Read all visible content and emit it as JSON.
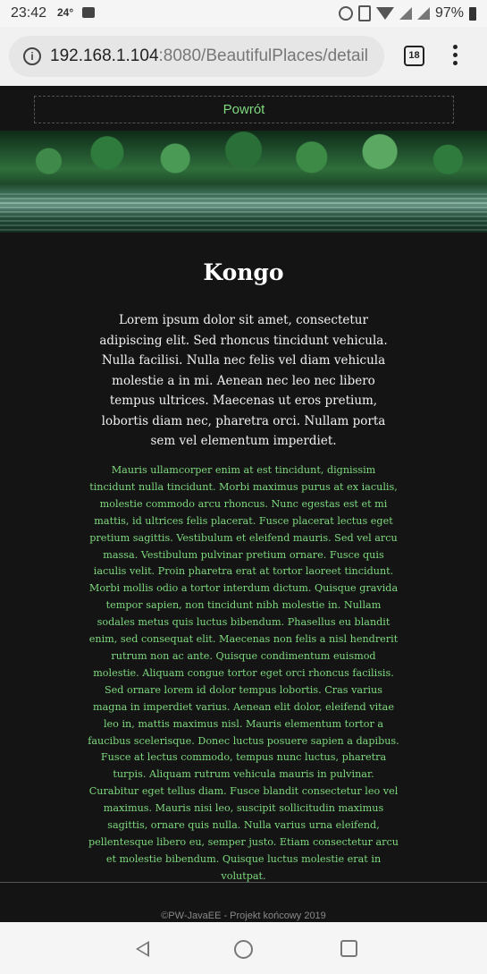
{
  "status_bar": {
    "time": "23:42",
    "temperature": "24°",
    "battery": "97%",
    "icons": [
      "image-icon",
      "alarm-icon",
      "vibrate-icon",
      "wifi-icon",
      "signal-icon",
      "battery-icon"
    ]
  },
  "browser": {
    "url_host": "192.168.1.104",
    "url_rest": ":8080/BeautifulPlaces/detail",
    "tab_count": "18",
    "info_icon_glyph": "i"
  },
  "page": {
    "back_button": "Powrót",
    "title": "Kongo",
    "intro": "Lorem ipsum dolor sit amet, consectetur adipiscing elit. Sed rhoncus tincidunt vehicula. Nulla facilisi. Nulla nec felis vel diam vehicula molestie a in mi. Aenean nec leo nec libero tempus ultrices. Maecenas ut eros pretium, lobortis diam nec, pharetra orci. Nullam porta sem vel elementum imperdiet.",
    "body": "Mauris ullamcorper enim at est tincidunt, dignissim tincidunt nulla tincidunt. Morbi maximus purus at ex iaculis, molestie commodo arcu rhoncus. Nunc egestas est et mi mattis, id ultrices felis placerat. Fusce placerat lectus eget pretium sagittis. Vestibulum et eleifend mauris. Sed vel arcu massa. Vestibulum pulvinar pretium ornare. Fusce quis iaculis velit. Proin pharetra erat at tortor laoreet tincidunt. Morbi mollis odio a tortor interdum dictum. Quisque gravida tempor sapien, non tincidunt nibh molestie in. Nullam sodales metus quis luctus bibendum. Phasellus eu blandit enim, sed consequat elit. Maecenas non felis a nisl hendrerit rutrum non ac ante. Quisque condimentum euismod molestie. Aliquam congue tortor eget orci rhoncus facilisis. Sed ornare lorem id dolor tempus lobortis. Cras varius magna in imperdiet varius. Aenean elit dolor, eleifend vitae leo in, mattis maximus nisl. Mauris elementum tortor a faucibus scelerisque. Donec luctus posuere sapien a dapibus. Fusce at lectus commodo, tempus nunc luctus, pharetra turpis. Aliquam rutrum vehicula mauris in pulvinar. Curabitur eget tellus diam. Fusce blandit consectetur leo vel maximus. Mauris nisi leo, suscipit sollicitudin maximus sagittis, ornare quis nulla. Nulla varius urna eleifend, pellentesque libero eu, semper justo. Etiam consectetur arcu et molestie bibendum. Quisque luctus molestie erat in volutpat.",
    "footer": "©PW-JavaEE - Projekt końcowy 2019"
  },
  "colors": {
    "background": "#141414",
    "accent_green": "#7ed87e",
    "title": "#ffffff"
  }
}
